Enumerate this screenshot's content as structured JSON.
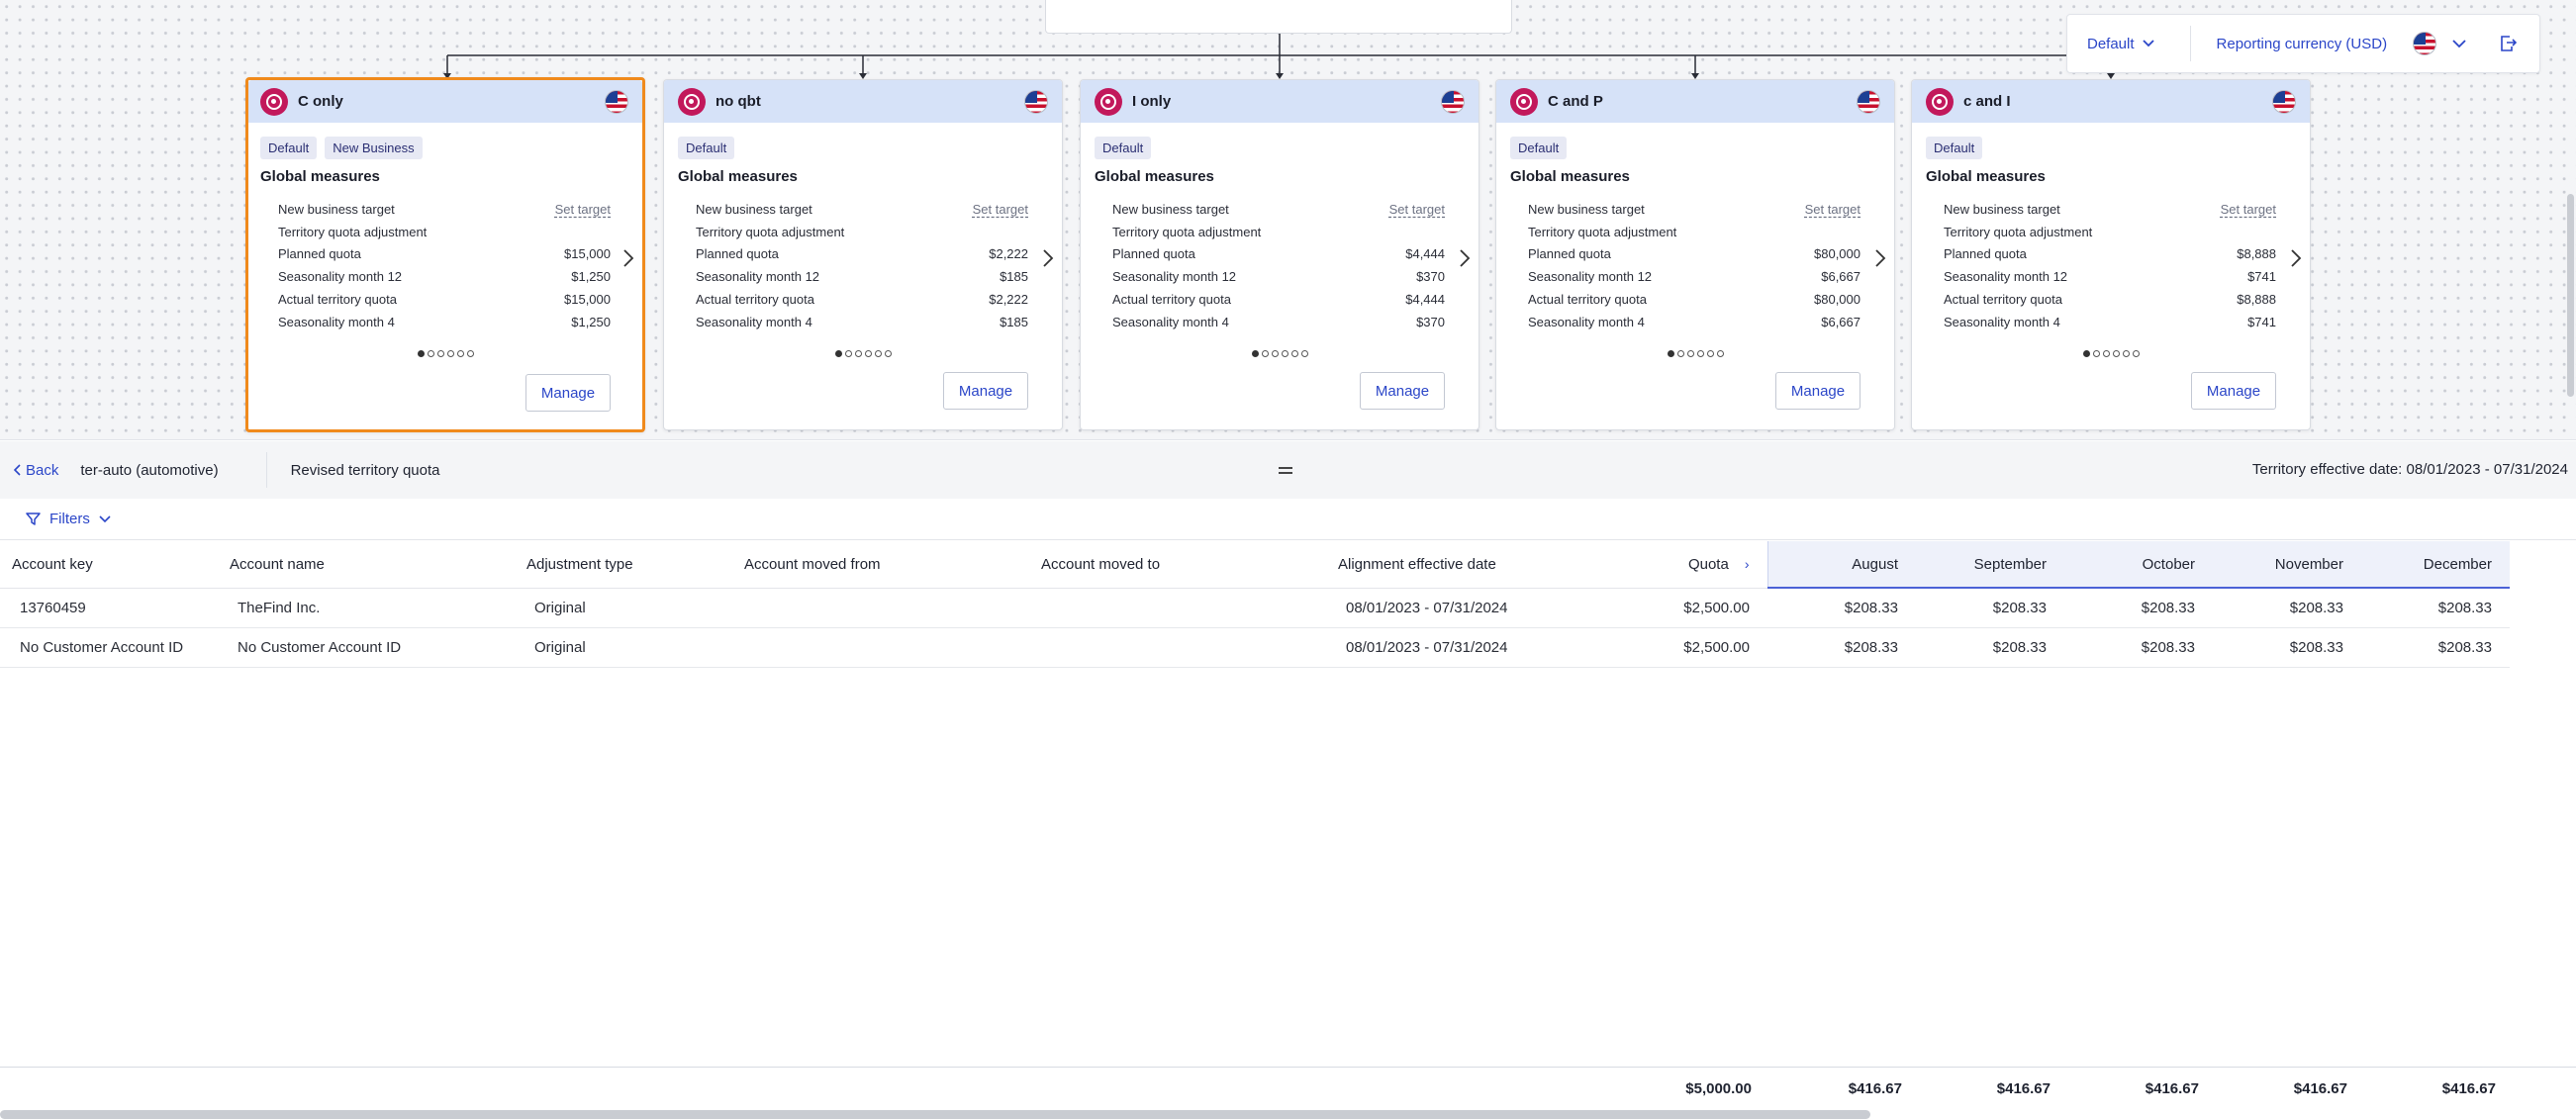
{
  "view_controls": {
    "default_label": "Default",
    "currency_label": "Reporting currency (USD)"
  },
  "cards": [
    {
      "title": "C only",
      "badges": [
        "Default",
        "New Business"
      ],
      "subtitle": "Global measures",
      "rows": [
        {
          "label": "New business target",
          "value": "Set target",
          "is_link": true
        },
        {
          "label": "Territory quota adjustment",
          "value": ""
        },
        {
          "label": "Planned quota",
          "value": "$15,000"
        },
        {
          "label": "Seasonality month 12",
          "value": "$1,250"
        },
        {
          "label": "Actual territory quota",
          "value": "$15,000"
        },
        {
          "label": "Seasonality month 4",
          "value": "$1,250"
        }
      ],
      "manage_label": "Manage",
      "selected": true
    },
    {
      "title": "no qbt",
      "badges": [
        "Default"
      ],
      "subtitle": "Global measures",
      "rows": [
        {
          "label": "New business target",
          "value": "Set target",
          "is_link": true
        },
        {
          "label": "Territory quota adjustment",
          "value": ""
        },
        {
          "label": "Planned quota",
          "value": "$2,222"
        },
        {
          "label": "Seasonality month 12",
          "value": "$185"
        },
        {
          "label": "Actual territory quota",
          "value": "$2,222"
        },
        {
          "label": "Seasonality month 4",
          "value": "$185"
        }
      ],
      "manage_label": "Manage",
      "selected": false
    },
    {
      "title": "I only",
      "badges": [
        "Default"
      ],
      "subtitle": "Global measures",
      "rows": [
        {
          "label": "New business target",
          "value": "Set target",
          "is_link": true
        },
        {
          "label": "Territory quota adjustment",
          "value": ""
        },
        {
          "label": "Planned quota",
          "value": "$4,444"
        },
        {
          "label": "Seasonality month 12",
          "value": "$370"
        },
        {
          "label": "Actual territory quota",
          "value": "$4,444"
        },
        {
          "label": "Seasonality month 4",
          "value": "$370"
        }
      ],
      "manage_label": "Manage",
      "selected": false
    },
    {
      "title": "C and P",
      "badges": [
        "Default"
      ],
      "subtitle": "Global measures",
      "rows": [
        {
          "label": "New business target",
          "value": "Set target",
          "is_link": true
        },
        {
          "label": "Territory quota adjustment",
          "value": ""
        },
        {
          "label": "Planned quota",
          "value": "$80,000"
        },
        {
          "label": "Seasonality month 12",
          "value": "$6,667"
        },
        {
          "label": "Actual territory quota",
          "value": "$80,000"
        },
        {
          "label": "Seasonality month 4",
          "value": "$6,667"
        }
      ],
      "manage_label": "Manage",
      "selected": false
    },
    {
      "title": "c and I",
      "badges": [
        "Default"
      ],
      "subtitle": "Global measures",
      "rows": [
        {
          "label": "New business target",
          "value": "Set target",
          "is_link": true
        },
        {
          "label": "Territory quota adjustment",
          "value": ""
        },
        {
          "label": "Planned quota",
          "value": "$8,888"
        },
        {
          "label": "Seasonality month 12",
          "value": "$741"
        },
        {
          "label": "Actual territory quota",
          "value": "$8,888"
        },
        {
          "label": "Seasonality month 4",
          "value": "$741"
        }
      ],
      "manage_label": "Manage",
      "selected": false
    }
  ],
  "panel": {
    "back_label": "Back",
    "territory": "ter-auto (automotive)",
    "section": "Revised territory quota",
    "effective_date": "Territory effective date: 08/01/2023 - 07/31/2024",
    "filters_label": "Filters"
  },
  "table": {
    "columns": [
      "Account key",
      "Account name",
      "Adjustment type",
      "Account moved from",
      "Account moved to",
      "Alignment effective date",
      "Quota",
      "August",
      "September",
      "October",
      "November",
      "December"
    ],
    "rows": [
      [
        "13760459",
        "TheFind Inc.",
        "Original",
        "",
        "",
        "08/01/2023 - 07/31/2024",
        "$2,500.00",
        "$208.33",
        "$208.33",
        "$208.33",
        "$208.33",
        "$208.33"
      ],
      [
        "No Customer Account ID",
        "No Customer Account ID",
        "Original",
        "",
        "",
        "08/01/2023 - 07/31/2024",
        "$2,500.00",
        "$208.33",
        "$208.33",
        "$208.33",
        "$208.33",
        "$208.33"
      ]
    ],
    "totals": [
      "$5,000.00",
      "$416.67",
      "$416.67",
      "$416.67",
      "$416.67",
      "$416.67"
    ]
  },
  "colors": {
    "accent": "#2b46c8",
    "selected_border": "#f08a1c",
    "card_header": "#d6e2f8",
    "node_icon": "#c2185b"
  }
}
